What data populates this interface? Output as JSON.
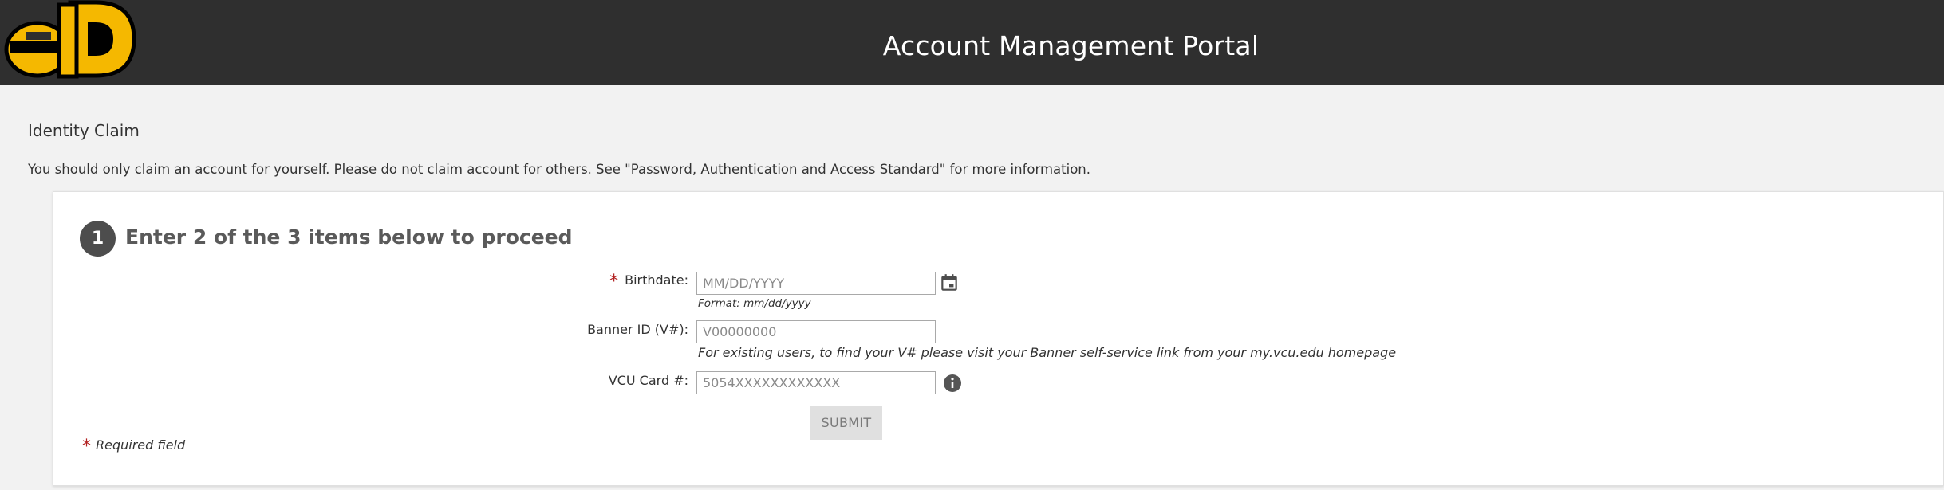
{
  "header": {
    "title": "Account Management Portal",
    "logo_text": "eID",
    "background": "#2f2f2f",
    "logo_color": "#f5b800"
  },
  "page": {
    "heading": "Identity Claim",
    "notice": "You should only claim an account for yourself. Please do not claim account for others. See \"Password, Authentication and Access Standard\" for more information."
  },
  "step": {
    "number": "1",
    "title": "Enter 2 of the 3 items below to proceed"
  },
  "fields": {
    "birthdate": {
      "required_mark": "*",
      "label": "Birthdate:",
      "placeholder": "MM/DD/YYYY",
      "hint": "Format: mm/dd/yyyy",
      "icon": "calendar-icon"
    },
    "banner_id": {
      "label": "Banner ID (V#):",
      "placeholder": "V00000000",
      "hint": "For existing users, to find your V# please visit your Banner self-service link from your my.vcu.edu homepage"
    },
    "vcu_card": {
      "label": "VCU Card #:",
      "placeholder": "5054XXXXXXXXXXXX",
      "icon": "info-icon"
    }
  },
  "submit_label": "SUBMIT",
  "required_note": {
    "mark": "*",
    "text": "Required field"
  }
}
